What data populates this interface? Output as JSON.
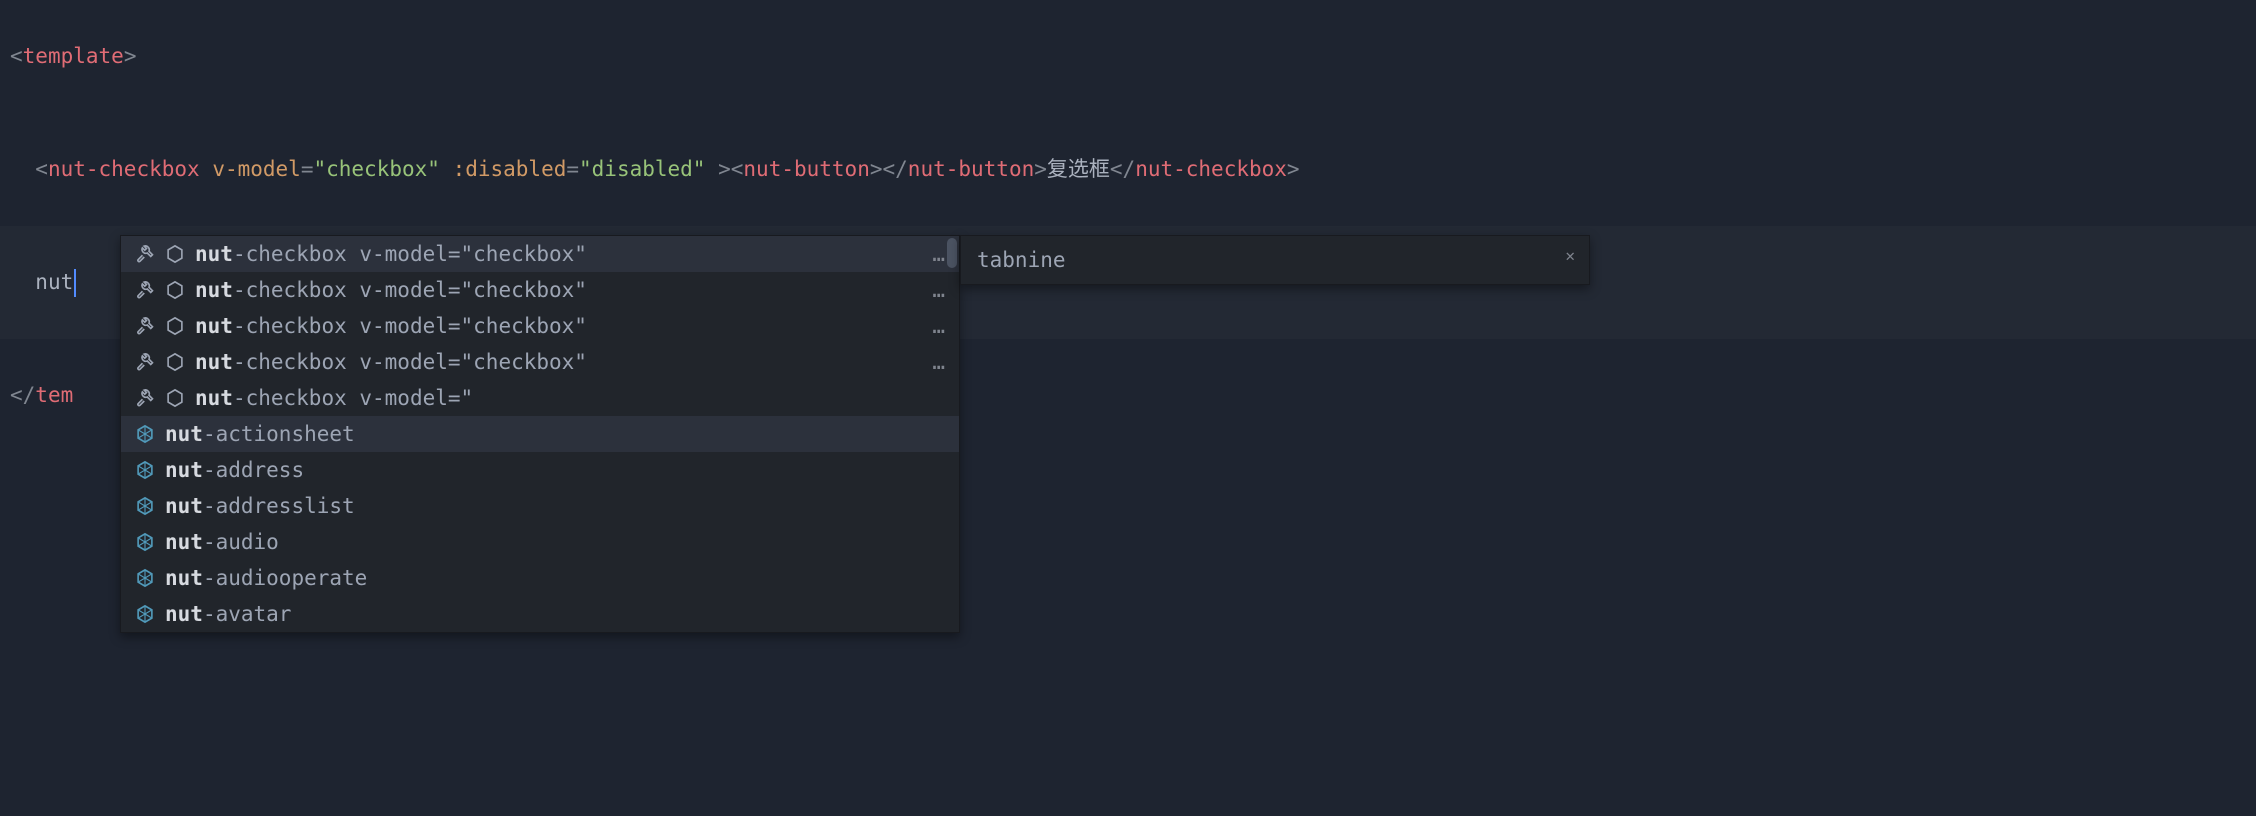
{
  "code": {
    "line1": {
      "open_bracket": "<",
      "tag": "template",
      "close_bracket": ">"
    },
    "line2": {
      "indent": "  ",
      "open_bracket": "<",
      "tag1": "nut-checkbox",
      "attr1_name": " v-model",
      "eq": "=",
      "attr1_value": "\"checkbox\"",
      "attr2_name": " :disabled",
      "attr2_value": "\"disabled\"",
      "space_gt": " >",
      "lt2": "<",
      "tag2": "nut-button",
      "gt2": ">",
      "lt3": "</",
      "tag3": "nut-button",
      "gt3": ">",
      "text": "复选框",
      "lt4": "</",
      "tag4": "nut-checkbox",
      "gt4": ">"
    },
    "line3": {
      "indent": "  ",
      "typed": "nut"
    },
    "line4": {
      "open_bracket": "</",
      "tag": "tem"
    }
  },
  "autocomplete": {
    "suggestions": [
      {
        "prefix": "nut",
        "rest": "-checkbox v-model=\"checkbox\" ",
        "ellipsis": "…",
        "icon": "snippet",
        "selected": true
      },
      {
        "prefix": "nut",
        "rest": "-checkbox v-model=\"checkbox\" ",
        "ellipsis": "…",
        "icon": "snippet"
      },
      {
        "prefix": "nut",
        "rest": "-checkbox v-model=\"checkbox\" ",
        "ellipsis": "…",
        "icon": "snippet"
      },
      {
        "prefix": "nut",
        "rest": "-checkbox v-model=\"checkbox\" ",
        "ellipsis": "…",
        "icon": "snippet"
      },
      {
        "prefix": "nut",
        "rest": "-checkbox v-model=\"",
        "ellipsis": "",
        "icon": "snippet"
      },
      {
        "prefix": "nut",
        "rest": "-actionsheet",
        "ellipsis": "",
        "icon": "component",
        "highlighted": true
      },
      {
        "prefix": "nut",
        "rest": "-address",
        "ellipsis": "",
        "icon": "component"
      },
      {
        "prefix": "nut",
        "rest": "-addresslist",
        "ellipsis": "",
        "icon": "component"
      },
      {
        "prefix": "nut",
        "rest": "-audio",
        "ellipsis": "",
        "icon": "component"
      },
      {
        "prefix": "nut",
        "rest": "-audiooperate",
        "ellipsis": "",
        "icon": "component"
      },
      {
        "prefix": "nut",
        "rest": "-avatar",
        "ellipsis": "",
        "icon": "component"
      }
    ],
    "detail": "tabnine"
  },
  "icons": {
    "wrench_color": "#9da5b4",
    "hex_color": "#9da5b4",
    "component_color": "#519aba"
  }
}
